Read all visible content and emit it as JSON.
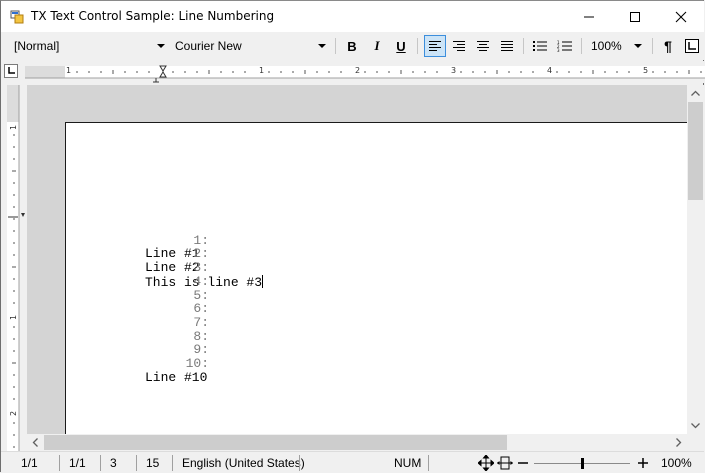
{
  "window": {
    "title": "TX Text Control Sample: Line Numbering",
    "controls": [
      "minimize-icon",
      "maximize-icon",
      "close-icon"
    ]
  },
  "toolbar": {
    "style_value": "[Normal]",
    "font_value": "Courier New",
    "zoom_value": "100%",
    "buttons": [
      "bold-icon",
      "italic-icon",
      "underline-icon",
      "align-left-icon",
      "align-right-icon",
      "align-center-icon",
      "justify-icon",
      "bullet-list-icon",
      "numbered-list-icon",
      "pilcrow-icon",
      "tab-stop-icon"
    ],
    "active_button": "align-left-icon",
    "bold_label": "B",
    "italic_label": "I",
    "underline_label": "U",
    "pilcrow_label": "¶"
  },
  "ruler": {
    "marks": [
      "1",
      "1",
      "2",
      "3",
      "4",
      "5"
    ]
  },
  "vruler": {
    "marks": [
      "1",
      "1",
      "2"
    ]
  },
  "document": {
    "lines": [
      {
        "num": "1:",
        "text": "Line #1"
      },
      {
        "num": "2:",
        "text": "Line #2"
      },
      {
        "num": "3:",
        "text": "This is line #3"
      },
      {
        "num": "4:",
        "text": ""
      },
      {
        "num": "5:",
        "text": ""
      },
      {
        "num": "6:",
        "text": ""
      },
      {
        "num": "7:",
        "text": ""
      },
      {
        "num": "8:",
        "text": ""
      },
      {
        "num": "9:",
        "text": ""
      },
      {
        "num": "10:",
        "text": "Line #10"
      }
    ]
  },
  "status": {
    "page": "1/1",
    "section": "1/1",
    "line": "3",
    "column": "15",
    "language": "English (United States)",
    "num": "NUM",
    "zoom": "100%",
    "zoom_level": 0.5
  },
  "colors": {
    "accent": "#3c8edc",
    "active_bg": "#cce4f7",
    "line_number": "#7a7a7a",
    "doc_background": "#d4d4d4"
  }
}
